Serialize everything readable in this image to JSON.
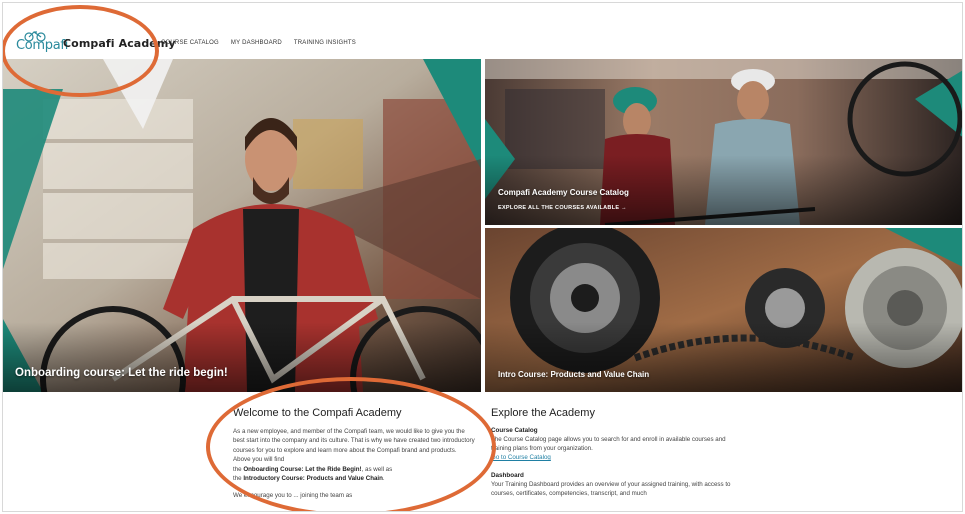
{
  "header": {
    "logo_text": "Compafi",
    "brand": "Compafi Academy",
    "nav": [
      "COURSE CATALOG",
      "MY DASHBOARD",
      "TRAINING INSIGHTS"
    ]
  },
  "tiles": {
    "main": {
      "title": "Onboarding course: Let the ride begin!"
    },
    "top_right": {
      "title": "Compafi Academy Course Catalog",
      "cta": "EXPLORE ALL THE COURSES AVAILABLE →"
    },
    "bottom_right": {
      "title": "Intro Course: Products and Value Chain"
    }
  },
  "welcome": {
    "heading": "Welcome to the Compafi Academy",
    "p1": "As a new employee, and member of the Compafi team, we would like to give you the best start into the company and its culture. That is why we have created two introductory courses for you to explore and learn more about the Compafi brand and products. Above you will find",
    "p1_line2_prefix": "the ",
    "course1": "Onboarding Course: Let the Ride Begin!",
    "p1_line2_suffix": ", as well as",
    "p1_line3_prefix": "the ",
    "course2": "Introductory Course: Products and Value Chain",
    "p1_line3_suffix": ".",
    "p2": "We encourage you to ... joining the team as"
  },
  "explore": {
    "heading": "Explore the Academy",
    "catalog_title": "Course Catalog",
    "catalog_text": "The Course Catalog page allows you to search for and enroll in available courses and training plans from your organization.",
    "catalog_link": "Go to Course Catalog",
    "dashboard_title": "Dashboard",
    "dashboard_text": "Your Training Dashboard provides an overview of your assigned training, with access to courses, certificates, competencies, transcript, and much"
  },
  "colors": {
    "accent_teal": "#1d8a7a",
    "annotation_orange": "#de6a36",
    "link_blue": "#1f7fa3"
  }
}
